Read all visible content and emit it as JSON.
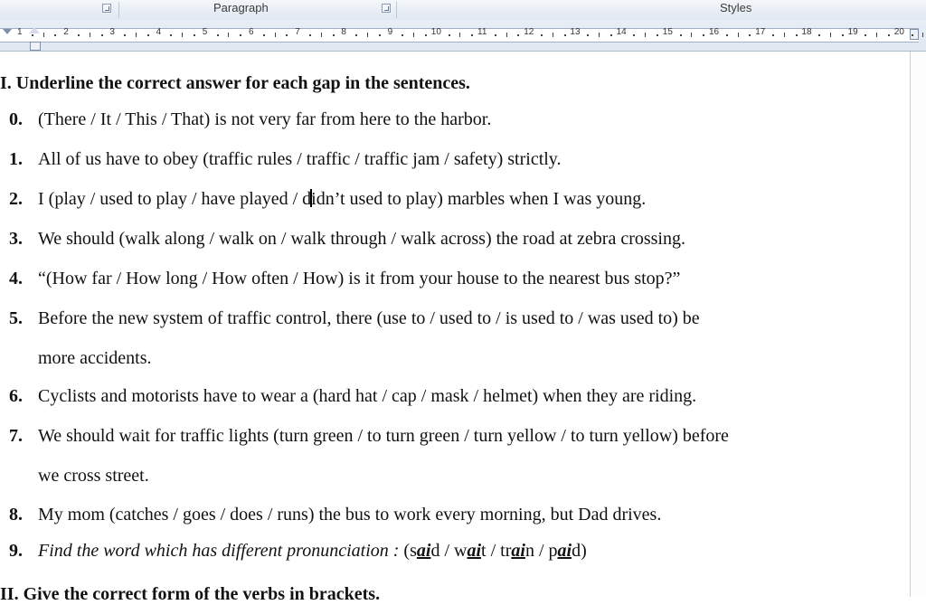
{
  "ribbon": {
    "paragraph_label": "Paragraph",
    "styles_label": "Styles"
  },
  "ruler": {
    "numbers": [
      "1",
      "2",
      "3",
      "4",
      "5",
      "6",
      "7",
      "8",
      "9",
      "10",
      "11",
      "12",
      "13",
      "14",
      "15",
      "16",
      "17",
      "18",
      "19",
      "20"
    ]
  },
  "document": {
    "heading": "I. Underline the correct answer for each gap in the sentences.",
    "items": [
      {
        "number": "0.",
        "text": "(There / It / This / That) is not very far from here to the harbor."
      },
      {
        "number": "1.",
        "text": "All of us have to obey (traffic rules / traffic / traffic jam / safety) strictly."
      },
      {
        "number": "2.",
        "text_before_caret": "I (play / used to play / have played / d",
        "text_after_caret": "idn’t used to play) marbles when I was young."
      },
      {
        "number": "3.",
        "text": "We should (walk along / walk on / walk through / walk across) the road at zebra crossing."
      },
      {
        "number": "4.",
        "text": "“(How far / How long / How often / How) is it from your house to the nearest bus stop?”"
      },
      {
        "number": "5.",
        "text": "Before the new system of traffic control, there (use to / used to / is used to / was used to) be",
        "continuation": "more accidents."
      },
      {
        "number": "6.",
        "text": "Cyclists and motorists have to wear a (hard hat / cap / mask / helmet) when they are riding."
      },
      {
        "number": "7.",
        "text": "We should wait for traffic lights (turn green / to turn green / turn yellow / to turn yellow) before",
        "continuation": "we cross street."
      },
      {
        "number": "8.",
        "text": "My mom (catches / goes / does / runs) the bus to work every morning, but Dad drives."
      },
      {
        "number": "9.",
        "instruction": "Find the word which has different pronunciation :",
        "words": [
          {
            "pre": "s",
            "focus": "ai",
            "post": "d"
          },
          {
            "pre": "w",
            "focus": "ai",
            "post": "t"
          },
          {
            "pre": "tr",
            "focus": "ai",
            "post": "n"
          },
          {
            "pre": "p",
            "focus": "ai",
            "post": "d"
          }
        ]
      }
    ],
    "heading2": "II. Give the correct form of the verbs in brackets."
  }
}
